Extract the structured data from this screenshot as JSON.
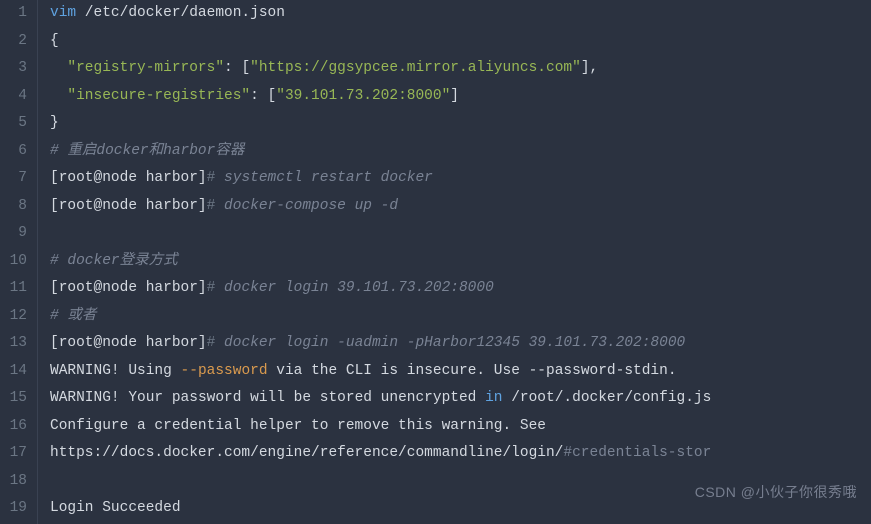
{
  "lines": {
    "l1": {
      "cmd": "vim",
      "path": " /etc/docker/daemon.json"
    },
    "l2": "{",
    "l3": {
      "key": "\"registry-mirrors\"",
      "sep": ": [",
      "val": "\"https://ggsypcee.mirror.aliyuncs.com\"",
      "end": "],"
    },
    "l4": {
      "key": "\"insecure-registries\"",
      "sep": ": [",
      "val": "\"39.101.73.202:8000\"",
      "end": "]"
    },
    "l5": "}",
    "l6": {
      "hash": "#",
      "txt": " 重启docker和harbor容器"
    },
    "l7": {
      "prompt": "[root@node harbor]",
      "hash": "#",
      "cmd": " systemctl restart docker"
    },
    "l8": {
      "prompt": "[root@node harbor]",
      "hash": "#",
      "cmd": " docker-compose up -d"
    },
    "l10": {
      "hash": "#",
      "txt": " docker登录方式"
    },
    "l11": {
      "prompt": "[root@node harbor]",
      "hash": "#",
      "cmd": " docker login 39.101.73.202:8000"
    },
    "l12": {
      "hash": "#",
      "txt": " 或者"
    },
    "l13": {
      "prompt": "[root@node harbor]",
      "hash": "#",
      "cmd": " docker login -uadmin -pHarbor12345 39.101.73.202:8000"
    },
    "l14": {
      "warn": "WARNING!",
      "a": " Using ",
      "flag": "--password",
      "b": " via the CLI is insecure. Use --password-stdin."
    },
    "l15": {
      "warn": "WARNING!",
      "a": " Your password will be stored unencrypted ",
      "kw": "in",
      "b": " /root/.docker/config.js"
    },
    "l16": "Configure a credential helper to remove this warning. See",
    "l17": {
      "url": "https://docs.docker.com/engine/reference/commandline/login/",
      "frag": "#credentials-stor"
    },
    "l19": "Login Succeeded"
  },
  "gutter": [
    "1",
    "2",
    "3",
    "4",
    "5",
    "6",
    "7",
    "8",
    "9",
    "10",
    "11",
    "12",
    "13",
    "14",
    "15",
    "16",
    "17",
    "18",
    "19"
  ],
  "watermark": "CSDN @小伙子你很秀哦"
}
